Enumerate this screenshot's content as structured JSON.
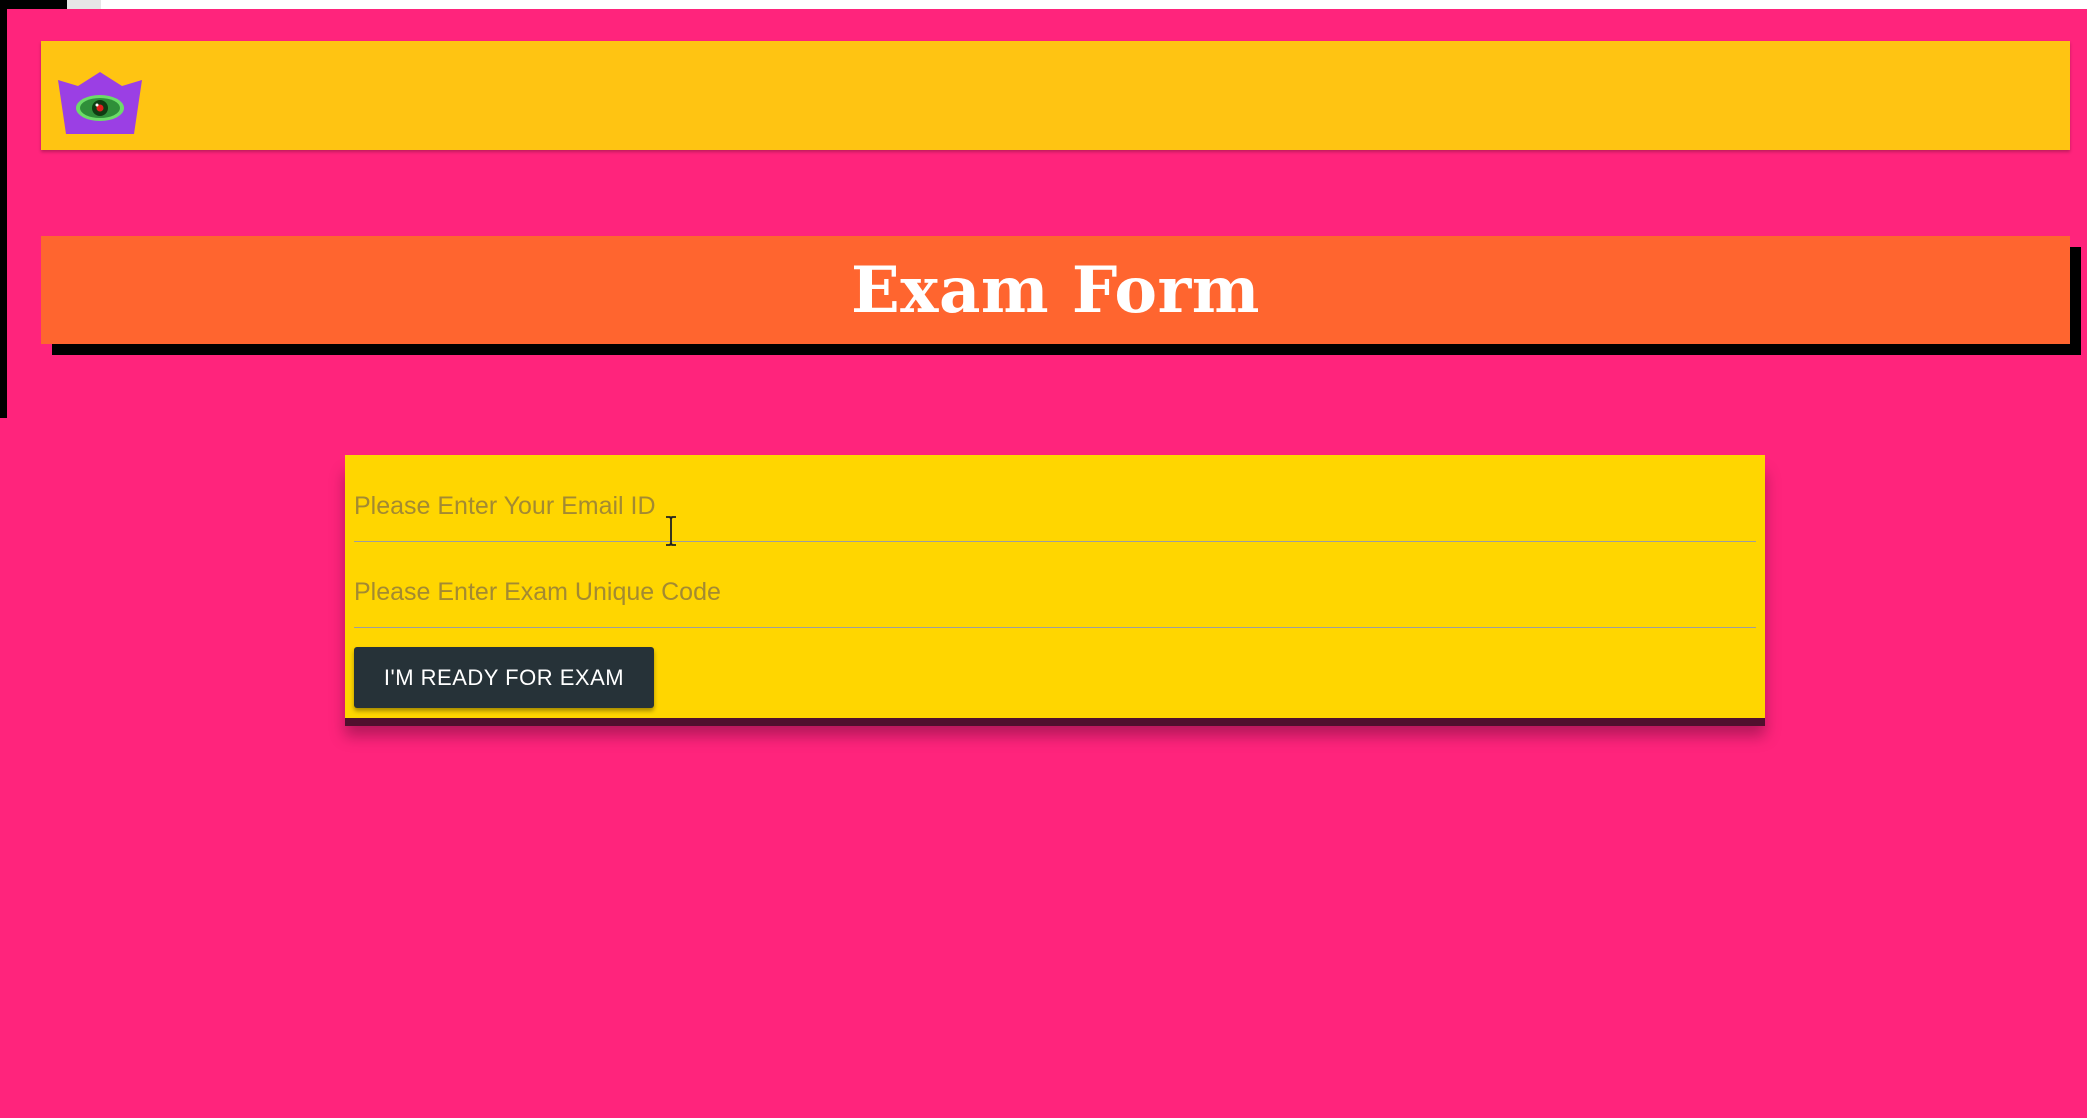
{
  "navbar": {
    "logo_icon": "eye-logo-icon"
  },
  "banner": {
    "title": "Exam Form"
  },
  "form": {
    "email_placeholder": "Please Enter Your Email ID",
    "code_placeholder": "Please Enter Exam Unique Code",
    "submit_label": "I'M READY FOR EXAM"
  },
  "colors": {
    "page_background": "#ff247c",
    "navbar": "#ffc412",
    "banner": "#ff652f",
    "form_card": "#ffd600",
    "button": "#263238"
  }
}
